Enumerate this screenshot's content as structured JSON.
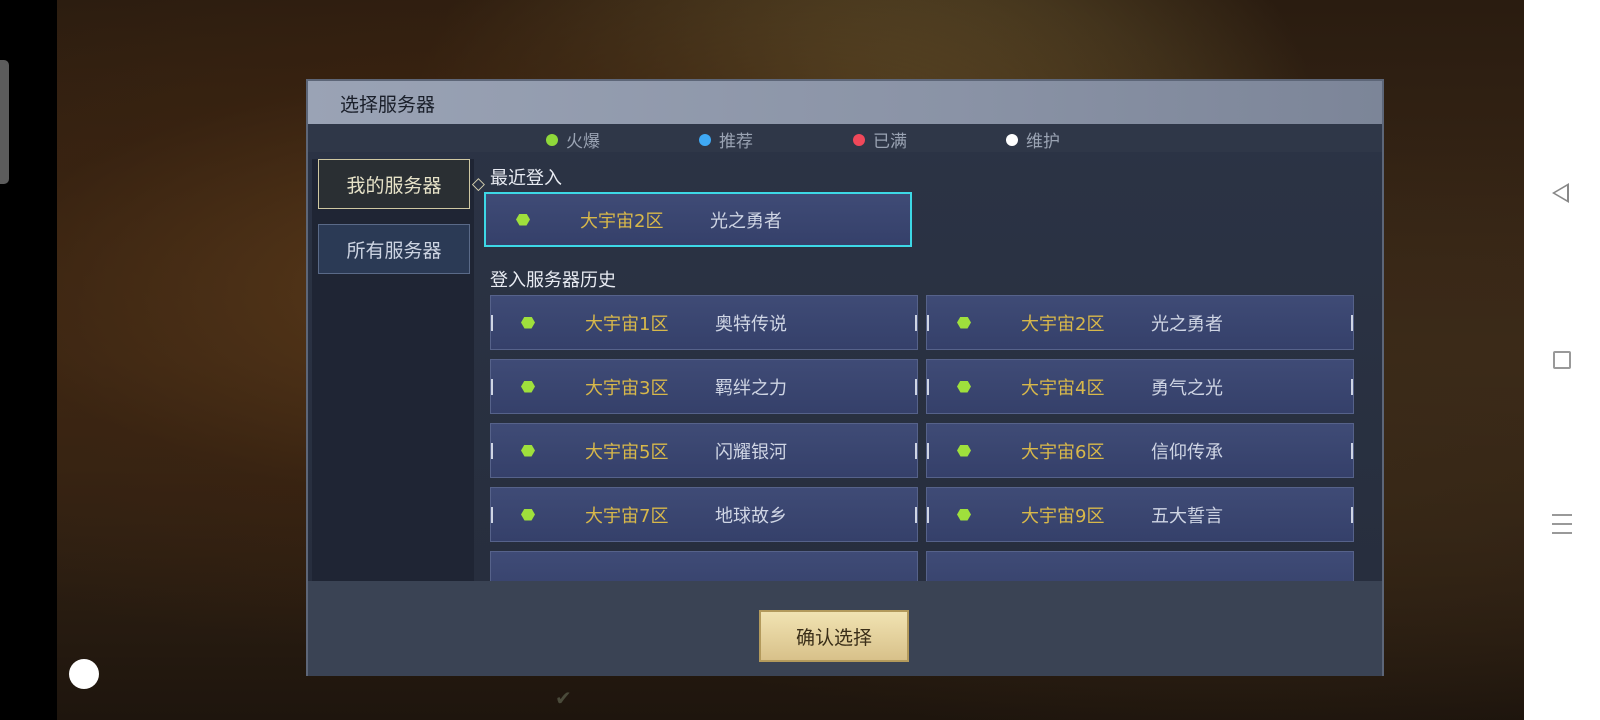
{
  "dialog": {
    "title": "选择服务器",
    "legend": [
      {
        "label": "火爆",
        "color": "#8fd83a"
      },
      {
        "label": "推荐",
        "color": "#3fa9f5"
      },
      {
        "label": "已满",
        "color": "#f0485a"
      },
      {
        "label": "维护",
        "color": "#ffffff"
      }
    ],
    "tabs": {
      "mine": "我的服务器",
      "all": "所有服务器",
      "active_marker": "◇"
    },
    "recent_label": "最近登入",
    "recent": {
      "zone": "大宇宙2区",
      "name": "光之勇者",
      "status_color": "#8fd83a"
    },
    "history_label": "登入服务器历史",
    "history": [
      {
        "zone": "大宇宙1区",
        "name": "奥特传说"
      },
      {
        "zone": "大宇宙2区",
        "name": "光之勇者"
      },
      {
        "zone": "大宇宙3区",
        "name": "羁绊之力"
      },
      {
        "zone": "大宇宙4区",
        "name": "勇气之光"
      },
      {
        "zone": "大宇宙5区",
        "name": "闪耀银河"
      },
      {
        "zone": "大宇宙6区",
        "name": "信仰传承"
      },
      {
        "zone": "大宇宙7区",
        "name": "地球故乡"
      },
      {
        "zone": "大宇宙9区",
        "name": "五大誓言"
      }
    ],
    "confirm_label": "确认选择"
  },
  "agreement_check": "✔",
  "system_nav": {
    "back_icon": "back-triangle",
    "home_icon": "square",
    "menu_icon": "three-lines"
  }
}
